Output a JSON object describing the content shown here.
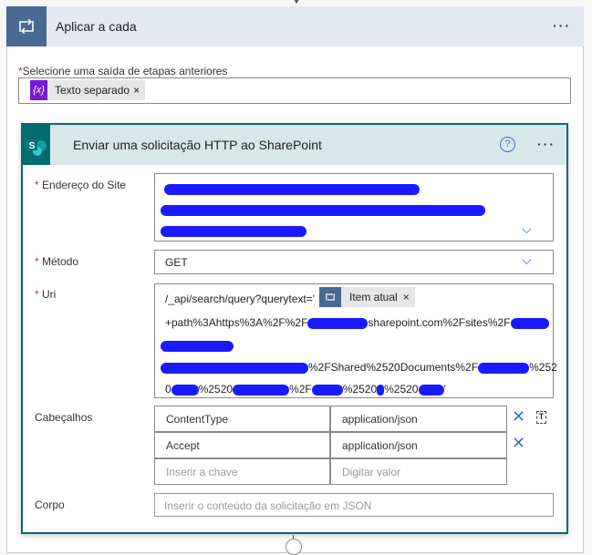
{
  "apply_each": {
    "title": "Aplicar a cada",
    "more": "···",
    "icon": "loop-icon",
    "select_label": "Selecione uma saída de etapas anteriores",
    "required_mark": "*",
    "token": {
      "icon": "{x}",
      "label": "Texto separado",
      "remove": "×"
    }
  },
  "action": {
    "title": "Enviar uma solicitação HTTP ao SharePoint",
    "help": "?",
    "more": "···",
    "icon": "sharepoint-icon",
    "site": {
      "label": "Endereço do Site",
      "required": true
    },
    "method": {
      "label": "Método",
      "value": "GET",
      "required": true
    },
    "uri": {
      "label": "Uri",
      "required": true,
      "line1": "/_api/search/query?querytext='",
      "token": {
        "label": "Item atual",
        "remove": "×"
      },
      "line2a": "+path%3Ahttps%3A%2F%2F",
      "line2b": "sharepoint.com%2Fsites%2F",
      "line4a": "%2FShared%2520Documents%2F",
      "line4b": "%252",
      "line5a": "0",
      "line5b": "%2520",
      "line5c": "%2F",
      "line5d": "%2520",
      "line5e": "%2520",
      "line5f": "'"
    },
    "headers": {
      "label": "Cabeçalhos",
      "rows": [
        {
          "key": "ContentType",
          "value": "application/json"
        },
        {
          "key": "Accept",
          "value": "application/json"
        }
      ],
      "key_placeholder": "Inserir a chave",
      "value_placeholder": "Digitar valor"
    },
    "body": {
      "label": "Corpo",
      "placeholder": "Inserir o conteúdo da solicitação em JSON"
    },
    "colors": {
      "accent": "#036c70",
      "loop": "#486991",
      "variable": "#7719d0"
    }
  }
}
